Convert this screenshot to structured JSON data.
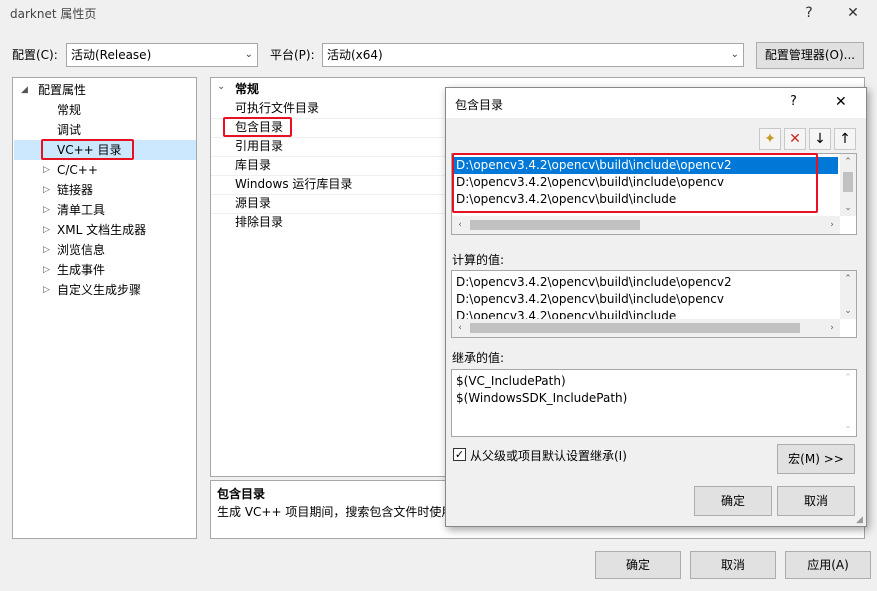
{
  "window": {
    "title": "darknet 属性页",
    "help_glyph": "?",
    "close_glyph": "✕"
  },
  "toolbar": {
    "config_label": "配置(C):",
    "config_value": "活动(Release)",
    "platform_label": "平台(P):",
    "platform_value": "活动(x64)",
    "config_manager_label": "配置管理器(O)..."
  },
  "tree": {
    "root": "配置属性",
    "items": [
      "常规",
      "调试",
      "VC++ 目录",
      "C/C++",
      "链接器",
      "清单工具",
      "XML 文档生成器",
      "浏览信息",
      "生成事件",
      "自定义生成步骤"
    ]
  },
  "grid": {
    "category": "常规",
    "rows": [
      "可执行文件目录",
      "包含目录",
      "引用目录",
      "库目录",
      "Windows 运行库目录",
      "源目录",
      "排除目录"
    ]
  },
  "description": {
    "title": "包含目录",
    "text": "生成 VC++ 项目期间，搜索包含文件时使用"
  },
  "dialog": {
    "title": "包含目录",
    "help_glyph": "?",
    "close_glyph": "✕",
    "entries": [
      "D:\\opencv3.4.2\\opencv\\build\\include\\opencv2",
      "D:\\opencv3.4.2\\opencv\\build\\include\\opencv",
      "D:\\opencv3.4.2\\opencv\\build\\include"
    ],
    "computed_label": "计算的值:",
    "computed": [
      "D:\\opencv3.4.2\\opencv\\build\\include\\opencv2",
      "D:\\opencv3.4.2\\opencv\\build\\include\\opencv",
      "D:\\opencv3.4.2\\opencv\\build\\include"
    ],
    "inherited_label": "继承的值:",
    "inherited": [
      "$(VC_IncludePath)",
      "$(WindowsSDK_IncludePath)"
    ],
    "inherit_checkbox_label": "从父级或项目默认设置继承(I)",
    "macro_label": "宏(M) >>",
    "ok_label": "确定",
    "cancel_label": "取消"
  },
  "footer": {
    "ok_label": "确定",
    "cancel_label": "取消",
    "apply_label": "应用(A)"
  },
  "colors": {
    "selection": "#0078d7",
    "highlight_box": "#e81123",
    "tree_selected": "#cce8ff"
  },
  "icons": [
    "new-line-icon",
    "delete-icon",
    "move-down-icon",
    "move-up-icon",
    "checkmark-icon"
  ]
}
